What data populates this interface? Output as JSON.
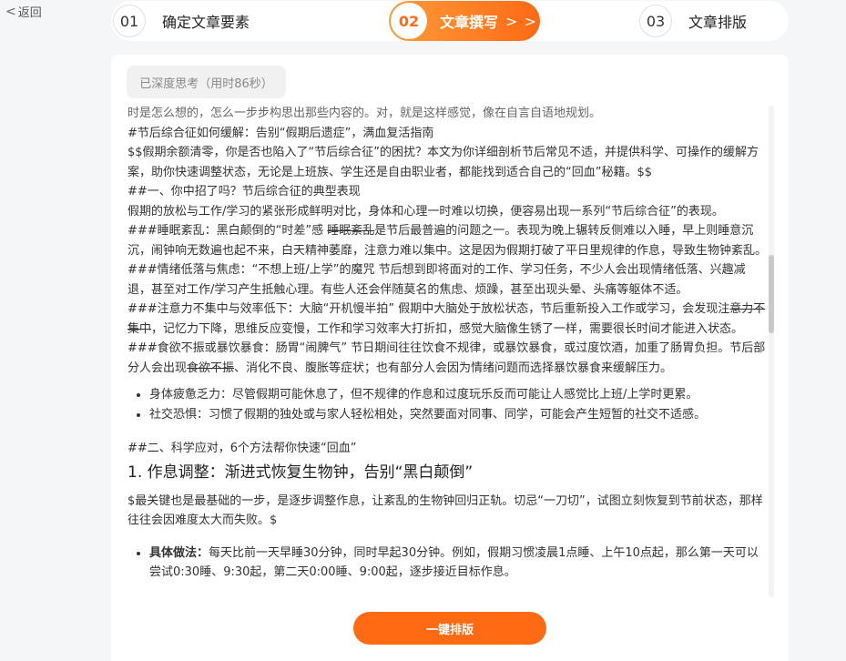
{
  "nav": {
    "back_label": "返回"
  },
  "steps": [
    {
      "num": "01",
      "label": "确定文章要素"
    },
    {
      "num": "02",
      "label": "文章撰写",
      "arrows": "> >"
    },
    {
      "num": "03",
      "label": "文章排版"
    }
  ],
  "thinking_badge": "已深度思考（用时86秒）",
  "article": {
    "clipped_line": "时是怎么想的，怎么一步步构思出那些内容的。对，就是这样感觉，像在自言自语地规划。",
    "title_line": "#节后综合征如何缓解：告别“假期后遗症”，满血复活指南",
    "intro_line": "$$假期余额清零，你是否也陷入了“节后综合征”的困扰？本文为你详细剖析节后常见不适，并提供科学、可操作的缓解方案，助你快速调整状态，无论是上班族、学生还是自由职业者，都能找到适合自己的“回血”秘籍。$$",
    "h_section1": "##一、你中招了吗？节后综合征的典型表现",
    "section1_intro": "假期的放松与工作/学习的紧张形成鲜明对比，身体和心理一时难以切换，便容易出现一系列“节后综合征”的表现。",
    "sleep_a": "###睡眠紊乱：黑白颠倒的“时差”感 ",
    "sleep_strike": "睡眠紊乱",
    "sleep_b": "是节后最普遍的问题之一。表现为晚上辗转反侧难以入睡，早上则睡意沉沉，闹钟响无数遍也起不来，白天精神萎靡，注意力难以集中。这是因为假期打破了平日里规律的作息，导致生物钟紊乱。",
    "mood_line": "###情绪低落与焦虑：“不想上班/上学”的魔咒 节后想到即将面对的工作、学习任务，不少人会出现情绪低落、兴趣减退，甚至对工作/学习产生抵触心理。有些人还会伴随莫名的焦虑、烦躁，甚至出现头晕、头痛等躯体不适。",
    "focus_a": "###注意力不集中与效率低下：大脑“开机慢半拍” 假期中大脑处于放松状态，节后重新投入工作或学习，会发现注",
    "focus_strike": "意力不集中",
    "focus_b": "，记忆力下降，思维反应变慢，工作和学习效率大打折扣，感觉大脑像生锈了一样，需要很长时间才能进入状态。",
    "diet_a": "###食欲不振或暴饮暴食：肠胃“闹脾气” 节日期间往往饮食不规律，或暴饮暴食，或过度饮酒，加重了肠胃负担。节后部分人会出现",
    "diet_strike": "食欲不振",
    "diet_b": "、消化不良、腹胀等症状；也有部分人会因为情绪问题而选择暴饮暴食来缓解压力。",
    "bullets1": [
      "身体疲惫乏力：尽管假期可能休息了，但不规律的作息和过度玩乐反而可能让人感觉比上班/上学时更累。",
      "社交恐惧：习惯了假期的独处或与家人轻松相处，突然要面对同事、同学，可能会产生短暂的社交不适感。"
    ],
    "h_section2": "##二、科学应对，6个方法帮你快速“回血”",
    "h_method1": "1. 作息调整：渐进式恢复生物钟，告别“黑白颠倒”",
    "method1_intro": "$最关键也是最基础的一步，是逐步调整作息，让紊乱的生物钟回归正轨。切忌“一刀切”，试图立刻恢复到节前状态，那样往往会因难度太大而失败。$",
    "method1_bullet_label": "具体做法：",
    "method1_bullet_text": "每天比前一天早睡30分钟，同时早起30分钟。例如，假期习惯凌晨1点睡、上午10点起，那么第一天可以尝试0:30睡、9:30起，第二天0:00睡、9:00起，逐步接近目标作息。"
  },
  "actions": {
    "format_label": "一键排版"
  }
}
